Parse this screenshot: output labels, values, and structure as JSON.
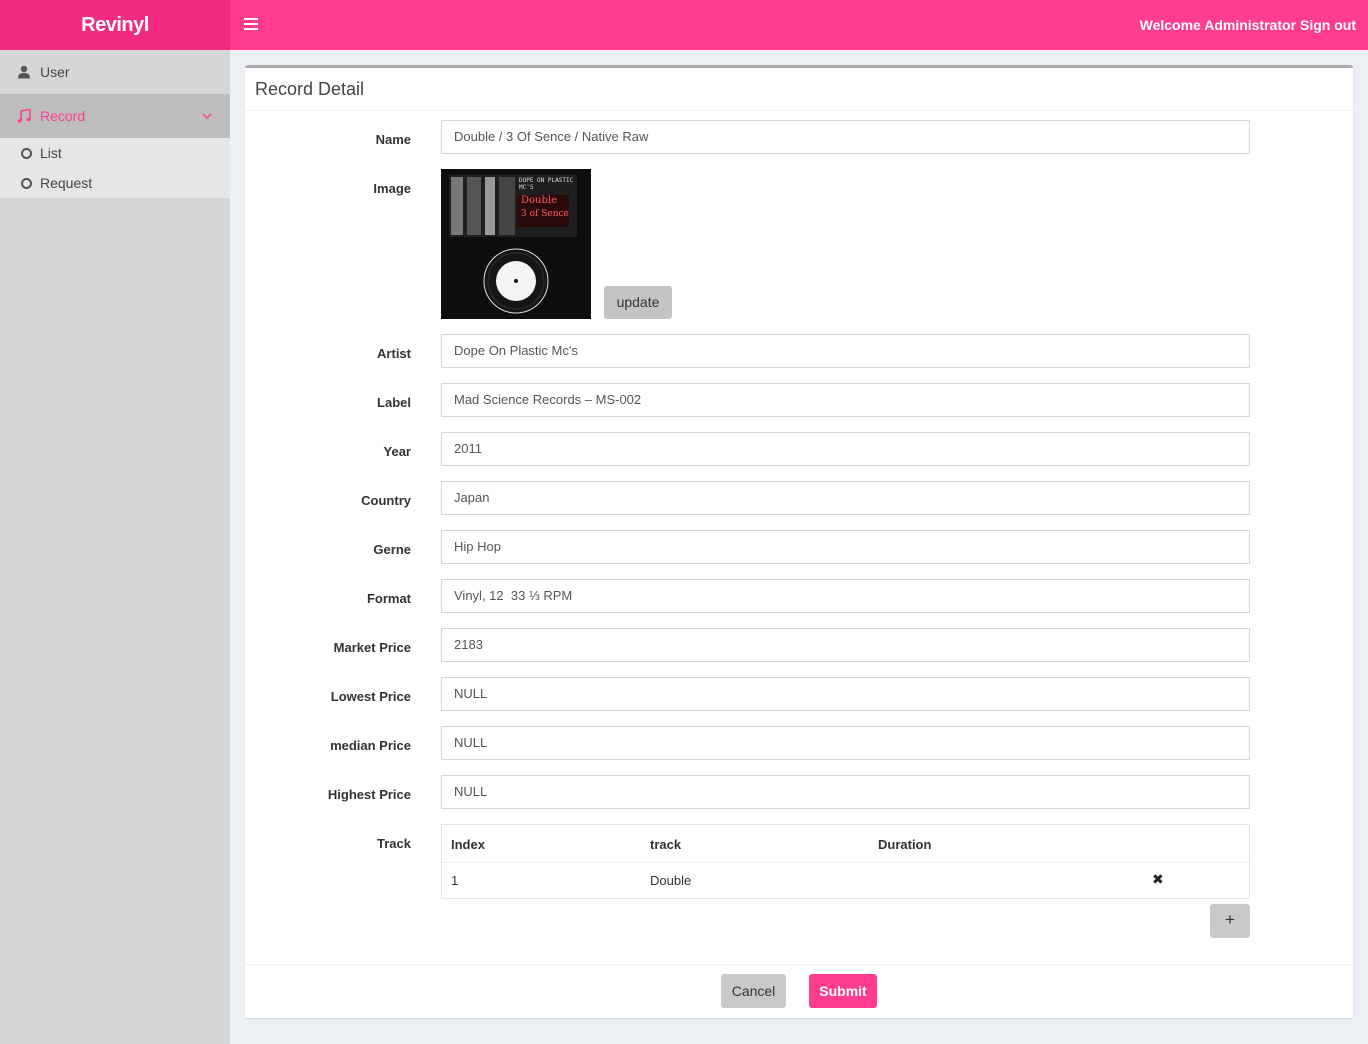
{
  "app": {
    "logo": "Revinyl"
  },
  "header": {
    "welcome": "Welcome Administrator",
    "signout": "Sign out"
  },
  "sidebar": {
    "items": [
      {
        "label": "User",
        "icon": "user-icon"
      },
      {
        "label": "Record",
        "icon": "music-icon",
        "active": true
      }
    ],
    "subitems": [
      {
        "label": "List"
      },
      {
        "label": "Request"
      }
    ]
  },
  "form": {
    "title": "Record Detail",
    "labels": {
      "name": "Name",
      "image": "Image",
      "artist": "Artist",
      "label": "Label",
      "year": "Year",
      "country": "Country",
      "genre": "Gerne",
      "format": "Format",
      "market_price": "Market Price",
      "lowest_price": "Lowest Price",
      "median_price": "median Price",
      "highest_price": "Highest Price",
      "track": "Track"
    },
    "values": {
      "name": "Double / 3 Of Sence / Native Raw",
      "artist": "Dope On Plastic Mc's",
      "label": "Mad Science Records – MS-002",
      "year": "2011",
      "country": "Japan",
      "genre": "Hip Hop",
      "format": "Vinyl, 12  33 ⅓ RPM",
      "market_price": "2183",
      "lowest_price": "NULL",
      "median_price": "NULL",
      "highest_price": "NULL"
    },
    "image": {
      "cover_text_top": "DOPE ON PLASTIC MC'S",
      "cover_text_title1": "Double",
      "cover_text_title2": "3 of Sence"
    },
    "update_label": "update",
    "tracks": {
      "headers": [
        "Index",
        "track",
        "Duration"
      ],
      "rows": [
        {
          "index": "1",
          "track": "Double",
          "duration": ""
        }
      ]
    },
    "add_label": "+",
    "cancel_label": "Cancel",
    "submit_label": "Submit"
  },
  "colors": {
    "accent": "#ff3c8e",
    "logo_bg": "#f22b80",
    "sidebar_bg": "#d6d6d6"
  }
}
